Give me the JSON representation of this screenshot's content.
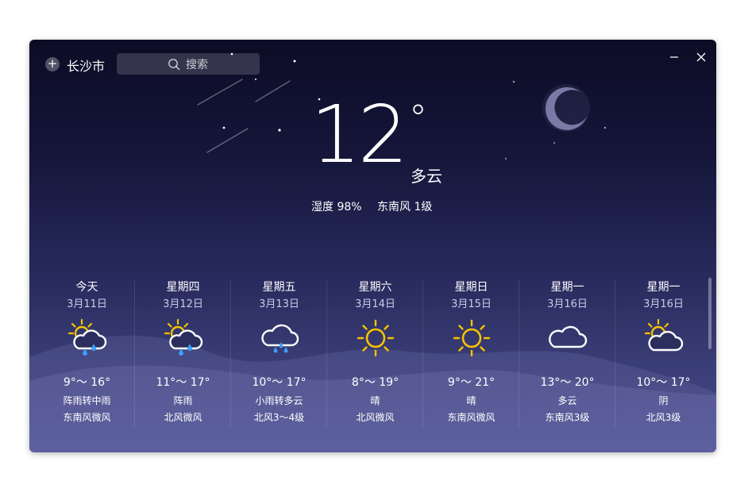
{
  "header": {
    "city": "长沙市",
    "search_placeholder": "搜索"
  },
  "current": {
    "temperature": "12",
    "unit": "°",
    "condition": "多云",
    "humidity": "湿度 98%",
    "wind": "东南风 1级"
  },
  "forecast": [
    {
      "day": "今天",
      "date": "3月11日",
      "range": "9°～ 16°",
      "desc": "阵雨转中雨",
      "wind": "东南风微风",
      "icon": "sun-cloud-rain-icon"
    },
    {
      "day": "星期四",
      "date": "3月12日",
      "range": "11°～ 17°",
      "desc": "阵雨",
      "wind": "北风微风",
      "icon": "sun-cloud-rain-icon"
    },
    {
      "day": "星期五",
      "date": "3月13日",
      "range": "10°～ 17°",
      "desc": "小雨转多云",
      "wind": "北风3～4级",
      "icon": "cloud-rain-icon"
    },
    {
      "day": "星期六",
      "date": "3月14日",
      "range": "8°～ 19°",
      "desc": "晴",
      "wind": "北风微风",
      "icon": "sun-icon"
    },
    {
      "day": "星期日",
      "date": "3月15日",
      "range": "9°～ 21°",
      "desc": "晴",
      "wind": "东南风微风",
      "icon": "sun-icon"
    },
    {
      "day": "星期一",
      "date": "3月16日",
      "range": "13°～ 20°",
      "desc": "多云",
      "wind": "东南风3级",
      "icon": "cloud-icon"
    },
    {
      "day": "星期一",
      "date": "3月16日",
      "range": "10°～ 17°",
      "desc": "阴",
      "wind": "北风3级",
      "icon": "sun-cloud-icon"
    }
  ],
  "colors": {
    "sun": "#f5c400",
    "rain": "#3aa0ff",
    "cloud": "#ffffff"
  }
}
